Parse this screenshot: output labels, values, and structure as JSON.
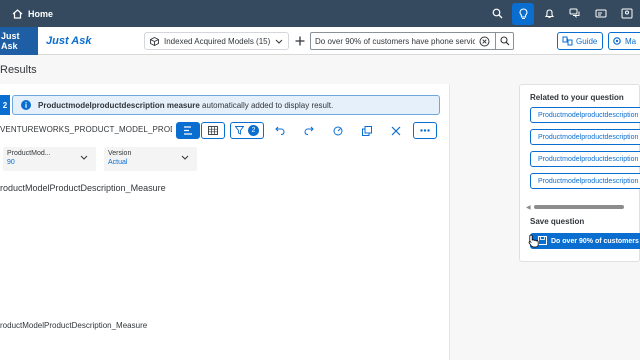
{
  "shell": {
    "home_label": "Home",
    "icons": [
      "search-icon",
      "lightbulb-icon",
      "bell-icon",
      "chat-icon",
      "notification-icon",
      "user-icon"
    ]
  },
  "subbar": {
    "app_tag": "Just Ask",
    "app_title": "Just Ask",
    "model_selector": "Indexed Acquired Models (15)",
    "question_value": "Do over 90% of customers have phone servic",
    "guide_label": "Guide",
    "manage_label": "Ma"
  },
  "page": {
    "section_title": "Results"
  },
  "main": {
    "result_count": "2",
    "info_bold": "Productmodelproductdescription measure",
    "info_rest": "automatically added to display result.",
    "dataset_name": "VENTUREWORKS_PRODUCT_MODEL_PRODU",
    "filter_badge": "2",
    "filters": [
      {
        "label": "ProductMod...",
        "value": "90"
      },
      {
        "label": "Version",
        "value": "Actual"
      }
    ],
    "chart_title": "roductModelProductDescription_Measure",
    "axis_label": "roductModelProductDescription_Measure"
  },
  "side": {
    "related_heading": "Related to your question",
    "related_items": [
      "Productmodelproductdescription",
      "Productmodelproductdescription",
      "Productmodelproductdescription",
      "Productmodelproductdescription"
    ],
    "save_heading": "Save question",
    "save_button": "Do over 90% of customers"
  },
  "colors": {
    "shell": "#354a5f",
    "accent": "#0a6ed1",
    "info_bg": "#e5f0fa"
  }
}
